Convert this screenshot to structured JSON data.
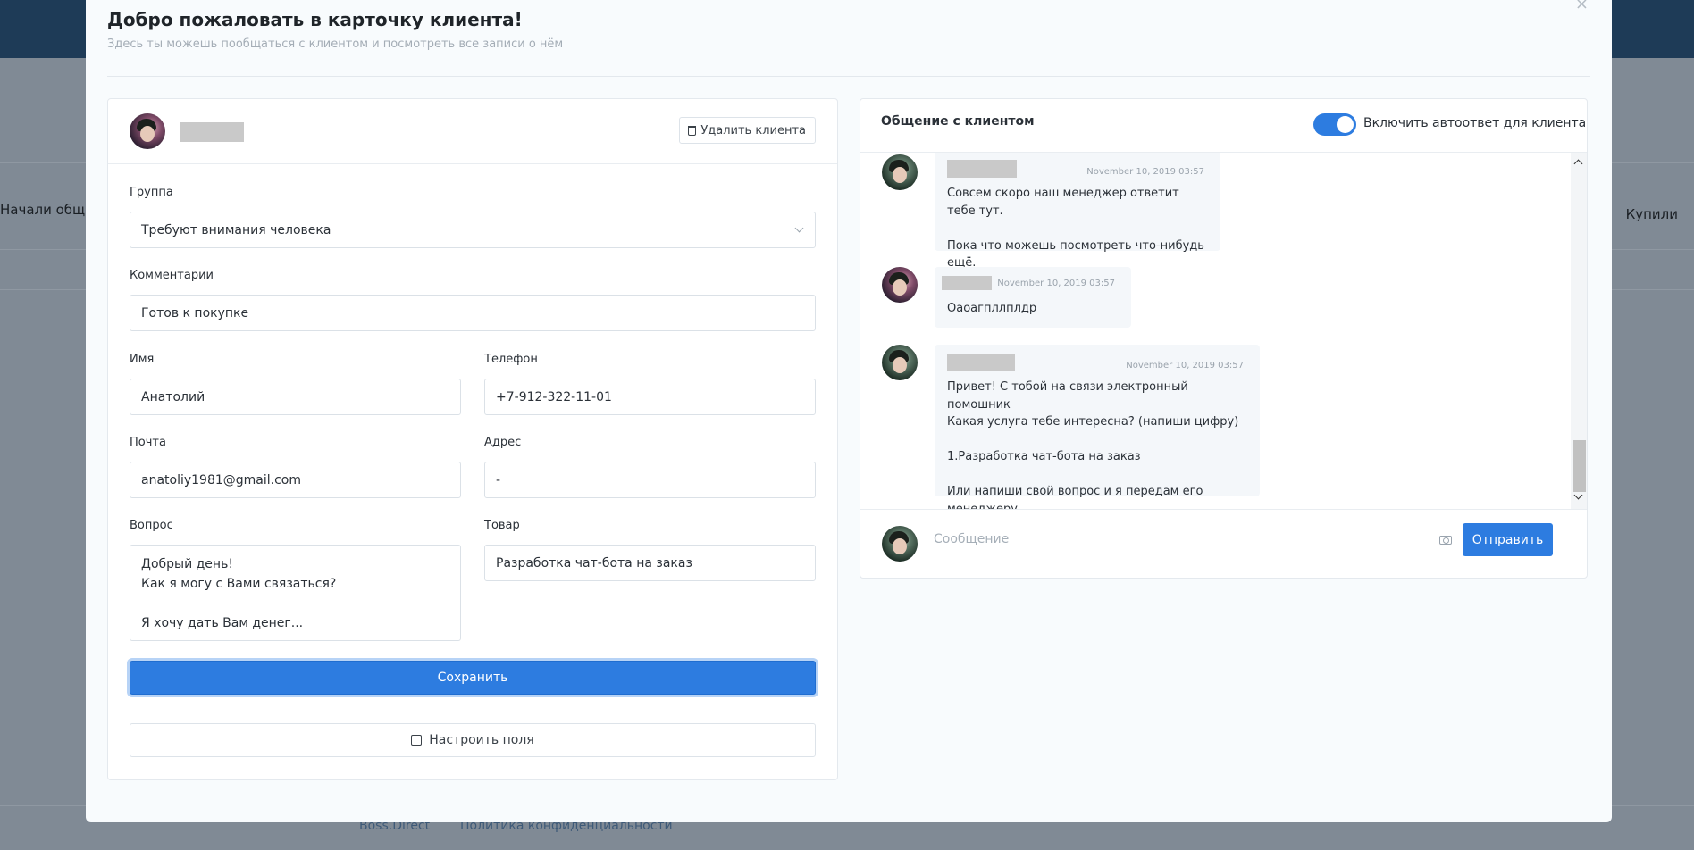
{
  "background": {
    "left_label": "Начали общат",
    "right_label": "Купили",
    "footer_links": [
      "Boss.Direct",
      "Политика конфиденциальности"
    ]
  },
  "modal": {
    "close": "×",
    "title": "Добро пожаловать в карточку клиента!",
    "subtitle": "Здесь ты можешь пообщаться с клиентом и посмотреть все записи о нём"
  },
  "client_card": {
    "delete_label": "Удалить клиента",
    "fields": {
      "group_label": "Группа",
      "group_value": "Требуют внимания человека",
      "comments_label": "Комментарии",
      "comments_value": "Готов к покупке",
      "name_label": "Имя",
      "name_value": "Анатолий",
      "phone_label": "Телефон",
      "phone_value": "+7-912-322-11-01",
      "email_label": "Почта",
      "email_value": "anatoliy1981@gmail.com",
      "address_label": "Адрес",
      "address_value": "-",
      "question_label": "Вопрос",
      "question_value": "Добрый день!\nКак я могу с Вами связаться?\n\nЯ хочу дать Вам денег...",
      "product_label": "Товар",
      "product_value": "Разработка чат-бота на заказ"
    },
    "save_label": "Сохранить",
    "configure_label": "Настроить поля"
  },
  "chat": {
    "title": "Общение с клиентом",
    "autoreply_label": "Включить автоответ для клиента",
    "autoreply_on": true,
    "messages": [
      {
        "time": "November 10, 2019 03:57",
        "text": "Совсем скоро наш менеджер ответит тебе тут.\n\nПока что можешь посмотреть что-нибудь ещё."
      },
      {
        "time": "November 10, 2019 03:57",
        "text": "Оаоагпллплдр"
      },
      {
        "time": "November 10, 2019 03:57",
        "text": "Привет! С тобой на связи электронный помошник\nКакая услуга тебе интересна? (напиши цифру)\n\n1.Разработка чат-бота на заказ\n\nИли напиши свой вопрос и я передам его менеджеру"
      }
    ],
    "message_placeholder": "Сообщение",
    "send_label": "Отправить"
  }
}
